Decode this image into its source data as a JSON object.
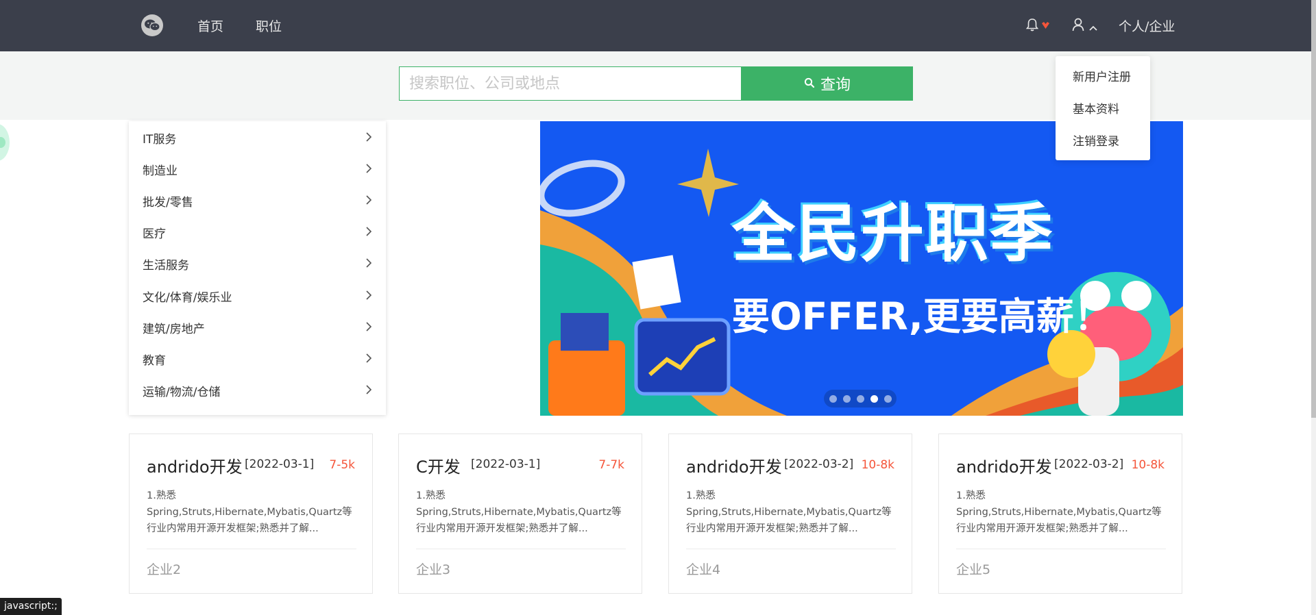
{
  "nav": {
    "home": "首页",
    "jobs": "职位",
    "role": "个人/企业"
  },
  "icons": {
    "logo": "wechat-icon",
    "notification": "bell-icon",
    "user": "user-icon",
    "search": "search-icon",
    "chevron": "chevron-right-icon"
  },
  "colors": {
    "topbar": "#3b3f4b",
    "accent_green": "#3cb267",
    "salary_red": "#f5553a",
    "banner_blue": "#1459f2"
  },
  "search": {
    "placeholder": "搜索职位、公司或地点",
    "button_label": "查询"
  },
  "user_menu": {
    "items": [
      "新用户注册",
      "基本资料",
      "注销登录"
    ]
  },
  "categories": [
    "IT服务",
    "制造业",
    "批发/零售",
    "医疗",
    "生活服务",
    "文化/体育/娱乐业",
    "建筑/房地产",
    "教育",
    "运输/物流/仓储"
  ],
  "banner": {
    "title": "全民升职季",
    "subtitle": "要OFFER,更要高薪！",
    "slide_count": 5,
    "active_slide": 4
  },
  "jobs": [
    {
      "title": "andrido开发",
      "date": "[2022-03-1]",
      "salary": "7-5k",
      "desc": "1.熟悉 Spring,Struts,Hibernate,Mybatis,Quartz等行业内常用开源开发框架;熟悉并了解...",
      "company": "企业2"
    },
    {
      "title": "C开发",
      "date": "[2022-03-1]",
      "salary": "7-7k",
      "desc": "1.熟悉 Spring,Struts,Hibernate,Mybatis,Quartz等行业内常用开源开发框架;熟悉并了解...",
      "company": "企业3"
    },
    {
      "title": "andrido开发",
      "date": "[2022-03-2]",
      "salary": "10-8k",
      "desc": "1.熟悉 Spring,Struts,Hibernate,Mybatis,Quartz等行业内常用开源开发框架;熟悉并了解...",
      "company": "企业4"
    },
    {
      "title": "andrido开发",
      "date": "[2022-03-2]",
      "salary": "10-8k",
      "desc": "1.熟悉 Spring,Struts,Hibernate,Mybatis,Quartz等行业内常用开源开发框架;熟悉并了解...",
      "company": "企业5"
    }
  ],
  "status_bar": "javascript:;"
}
